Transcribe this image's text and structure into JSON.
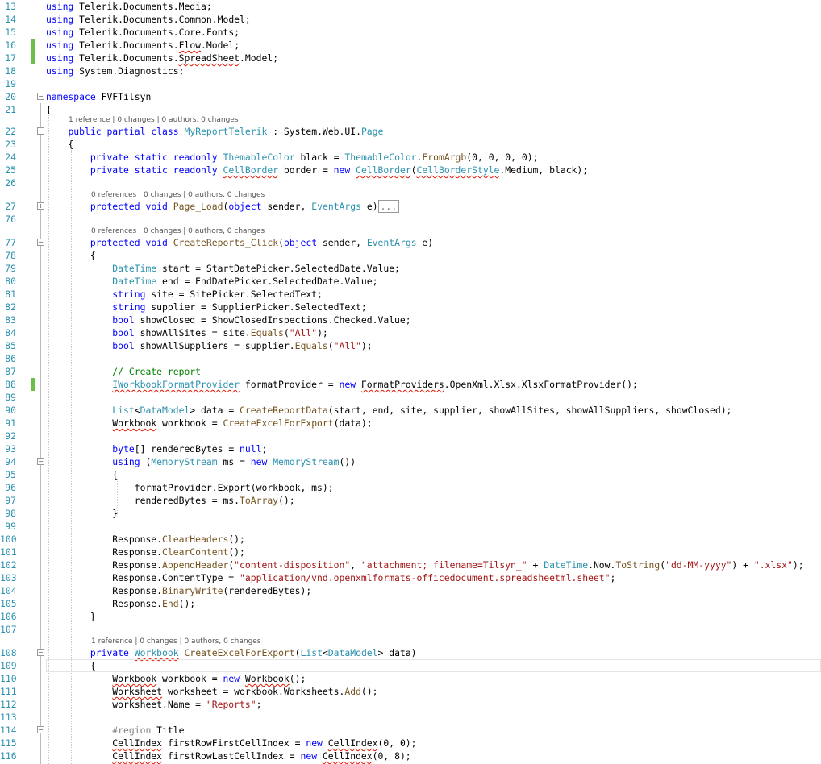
{
  "editor": {
    "language": "csharp",
    "change_bar_color": "#6cc04a",
    "line_number_color": "#2b91af",
    "lines": [
      {
        "n": "13",
        "text": "using Telerik.Documents.Media;"
      },
      {
        "n": "14",
        "text": "using Telerik.Documents.Common.Model;"
      },
      {
        "n": "15",
        "text": "using Telerik.Documents.Core.Fonts;"
      },
      {
        "n": "16",
        "text": "using Telerik.Documents.Flow.Model;"
      },
      {
        "n": "17",
        "text": "using Telerik.Documents.SpreadSheet.Model;"
      },
      {
        "n": "18",
        "text": "using System.Diagnostics;"
      },
      {
        "n": "19",
        "text": ""
      },
      {
        "n": "20",
        "text": "namespace FVFTilsyn"
      },
      {
        "n": "21",
        "text": "{"
      },
      {
        "n": "22",
        "text": "public partial class MyReportTelerik : System.Web.UI.Page"
      },
      {
        "n": "23",
        "text": "{"
      },
      {
        "n": "24",
        "text": "private static readonly ThemableColor black = ThemableColor.FromArgb(0, 0, 0, 0);"
      },
      {
        "n": "25",
        "text": "private static readonly CellBorder border = new CellBorder(CellBorderStyle.Medium, black);"
      },
      {
        "n": "26",
        "text": ""
      },
      {
        "n": "27",
        "text": "protected void Page_Load(object sender, EventArgs e)"
      },
      {
        "n": "76",
        "text": ""
      },
      {
        "n": "77",
        "text": "protected void CreateReports_Click(object sender, EventArgs e)"
      },
      {
        "n": "78",
        "text": "{"
      },
      {
        "n": "79",
        "text": "DateTime start = StartDatePicker.SelectedDate.Value;"
      },
      {
        "n": "80",
        "text": "DateTime end = EndDatePicker.SelectedDate.Value;"
      },
      {
        "n": "81",
        "text": "string site = SitePicker.SelectedText;"
      },
      {
        "n": "82",
        "text": "string supplier = SupplierPicker.SelectedText;"
      },
      {
        "n": "83",
        "text": "bool showClosed = ShowClosedInspections.Checked.Value;"
      },
      {
        "n": "84",
        "text": "bool showAllSites = site.Equals(\"All\");"
      },
      {
        "n": "85",
        "text": "bool showAllSuppliers = supplier.Equals(\"All\");"
      },
      {
        "n": "86",
        "text": ""
      },
      {
        "n": "87",
        "text": "// Create report"
      },
      {
        "n": "88",
        "text": "IWorkbookFormatProvider formatProvider = new FormatProviders.OpenXml.Xlsx.XlsxFormatProvider();"
      },
      {
        "n": "89",
        "text": ""
      },
      {
        "n": "90",
        "text": "List<DataModel> data = CreateReportData(start, end, site, supplier, showAllSites, showAllSuppliers, showClosed);"
      },
      {
        "n": "91",
        "text": "Workbook workbook = CreateExcelForExport(data);"
      },
      {
        "n": "92",
        "text": ""
      },
      {
        "n": "93",
        "text": "byte[] renderedBytes = null;"
      },
      {
        "n": "94",
        "text": "using (MemoryStream ms = new MemoryStream())"
      },
      {
        "n": "95",
        "text": "{"
      },
      {
        "n": "96",
        "text": "formatProvider.Export(workbook, ms);"
      },
      {
        "n": "97",
        "text": "renderedBytes = ms.ToArray();"
      },
      {
        "n": "98",
        "text": "}"
      },
      {
        "n": "99",
        "text": ""
      },
      {
        "n": "100",
        "text": "Response.ClearHeaders();"
      },
      {
        "n": "101",
        "text": "Response.ClearContent();"
      },
      {
        "n": "102",
        "text": "Response.AppendHeader(\"content-disposition\", \"attachment; filename=Tilsyn_\" + DateTime.Now.ToString(\"dd-MM-yyyy\") + \".xlsx\");"
      },
      {
        "n": "103",
        "text": "Response.ContentType = \"application/vnd.openxmlformats-officedocument.spreadsheetml.sheet\";"
      },
      {
        "n": "104",
        "text": "Response.BinaryWrite(renderedBytes);"
      },
      {
        "n": "105",
        "text": "Response.End();"
      },
      {
        "n": "106",
        "text": "}"
      },
      {
        "n": "107",
        "text": ""
      },
      {
        "n": "108",
        "text": "private Workbook CreateExcelForExport(List<DataModel> data)"
      },
      {
        "n": "109",
        "text": "{"
      },
      {
        "n": "110",
        "text": "Workbook workbook = new Workbook();"
      },
      {
        "n": "111",
        "text": "Worksheet worksheet = workbook.Worksheets.Add();"
      },
      {
        "n": "112",
        "text": "worksheet.Name = \"Reports\";"
      },
      {
        "n": "113",
        "text": ""
      },
      {
        "n": "114",
        "text": "#region Title"
      },
      {
        "n": "115",
        "text": "CellIndex firstRowFirstCellIndex = new CellIndex(0, 0);"
      },
      {
        "n": "116",
        "text": "CellIndex firstRowLastCellIndex = new CellIndex(0, 8);"
      }
    ],
    "codelens": {
      "class": "1 reference | 0 changes | 0 authors, 0 changes",
      "page_load": "0 references | 0 changes | 0 authors, 0 changes",
      "create_reports": "0 references | 0 changes | 0 authors, 0 changes",
      "create_excel": "1 reference | 0 changes | 0 authors, 0 changes"
    },
    "collapsed_marker": "..."
  }
}
